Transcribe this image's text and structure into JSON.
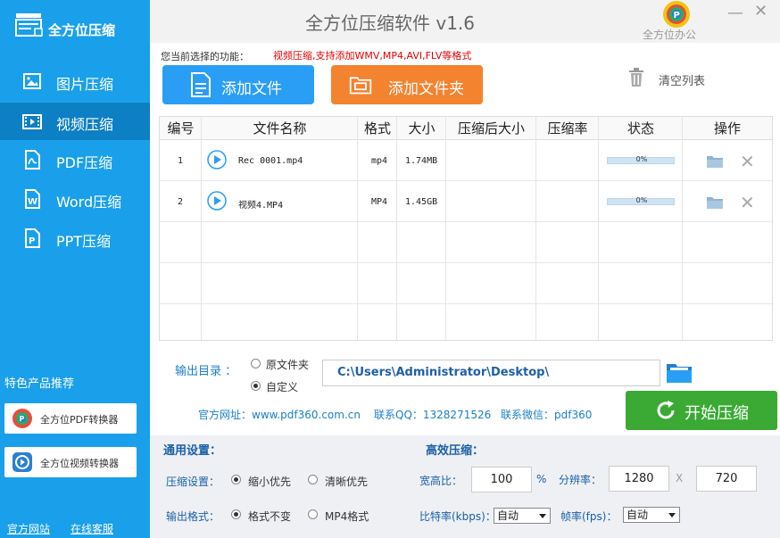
{
  "sidebar": {
    "logo_text": "全方位压缩",
    "nav": [
      {
        "label": "图片压缩",
        "icon": "image-icon"
      },
      {
        "label": "视频压缩",
        "icon": "video-icon",
        "active": true
      },
      {
        "label": "PDF压缩",
        "icon": "pdf-icon"
      },
      {
        "label": "Word压缩",
        "icon": "word-icon"
      },
      {
        "label": "PPT压缩",
        "icon": "ppt-icon"
      }
    ],
    "featured_title": "特色产品推荐",
    "products": [
      {
        "label": "全方位PDF转换器",
        "icon": "pdf-converter-icon"
      },
      {
        "label": "全方位视频转换器",
        "icon": "video-converter-icon"
      }
    ],
    "footer": {
      "website": "官方网站",
      "service": "在线客服"
    }
  },
  "titlebar": {
    "title": "全方位压缩软件 v1.6",
    "brand": "全方位办公",
    "minimize": "—",
    "close": "✕"
  },
  "toolbar": {
    "func_label": "您当前选择的功能：",
    "func_text": "视频压缩,支持添加WMV,MP4,AVI,FLV等格式",
    "add_file": "添加文件",
    "add_folder": "添加文件夹",
    "clear_list": "清空列表"
  },
  "table": {
    "headers": [
      "编号",
      "文件名称",
      "格式",
      "大小",
      "压缩后大小",
      "压缩率",
      "状态",
      "操作"
    ],
    "rows": [
      {
        "no": "1",
        "name": "Rec 0001.mp4",
        "format": "mp4",
        "size": "1.74MB",
        "compressed": "",
        "ratio": "",
        "progress": "0%"
      },
      {
        "no": "2",
        "name": "视频4.MP4",
        "format": "MP4",
        "size": "1.45GB",
        "compressed": "",
        "ratio": "",
        "progress": "0%"
      }
    ]
  },
  "output": {
    "label": "输出目录 ：",
    "opt_original": "原文件夹",
    "opt_custom": "自定义",
    "path": "C:\\Users\\Administrator\\Desktop\\"
  },
  "contact": {
    "website": "官方网址：www.pdf360.com.cn",
    "qq": "联系QQ：1328271526",
    "wechat": "联系微信：pdf360"
  },
  "start_button": "开始压缩",
  "settings": {
    "general_title": "通用设置：",
    "efficient_title": "高效压缩：",
    "compress_label": "压缩设置：",
    "compress_opts": [
      "缩小优先",
      "清晰优先"
    ],
    "format_label": "输出格式：",
    "format_opts": [
      "格式不变",
      "MP4格式"
    ],
    "aspect_label": "宽高比：",
    "aspect_value": "100",
    "percent": "%",
    "resolution_label": "分辨率：",
    "res_w": "1280",
    "res_x": "X",
    "res_h": "720",
    "bitrate_label": "比特率(kbps)：",
    "bitrate_value": "自动",
    "fps_label": "帧率(fps)：",
    "fps_value": "自动"
  }
}
